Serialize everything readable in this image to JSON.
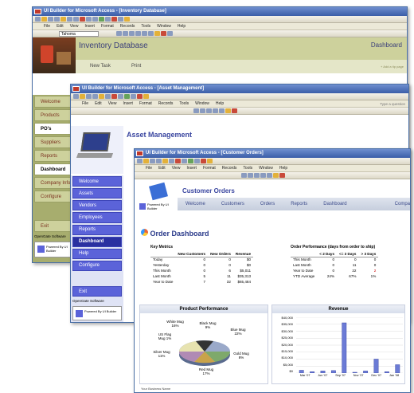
{
  "win1": {
    "title": "UI Builder for Microsoft Access - [Inventory Database]",
    "menu": [
      "File",
      "Edit",
      "View",
      "Insert",
      "Format",
      "Records",
      "Tools",
      "Window",
      "Help"
    ],
    "font": "Tahoma",
    "header": "Inventory Database",
    "right_title": "Dashboard",
    "new_task": "New Task",
    "print": "Print",
    "side": [
      "Welcome",
      "Products",
      "PO's",
      "Suppliers",
      "Reports",
      "Dashboard",
      "Company Info",
      "Configure",
      "Exit"
    ],
    "footer": "OpenGate Software",
    "powered": "Powered By UI Builder",
    "link": "+ Add a tip page"
  },
  "win2": {
    "title": "UI Builder for Microsoft Access - [Asset Management]",
    "menu": [
      "File",
      "Edit",
      "View",
      "Insert",
      "Format",
      "Records",
      "Tools",
      "Window",
      "Help"
    ],
    "help_box": "Type a question",
    "header": "Asset Management",
    "side": [
      "Welcome",
      "Assets",
      "Vendors",
      "Employees",
      "Reports",
      "Dashboard",
      "Help",
      "Configure",
      "Exit"
    ],
    "footer": "OpenGate Software",
    "powered": "Powered By UI Builder"
  },
  "win3": {
    "title": "UI Builder for Microsoft Access - [Customer Orders]",
    "menu": [
      "File",
      "Edit",
      "View",
      "Insert",
      "Format",
      "Records",
      "Tools",
      "Window",
      "Help"
    ],
    "header": "Customer Orders",
    "tabs": [
      "Welcome",
      "Customers",
      "Orders",
      "Reports",
      "Dashboard",
      "Compa"
    ],
    "powered": "Powered By UI Builder",
    "dash_title": "Order Dashboard",
    "key_metrics": {
      "title": "Key Metrics",
      "headers": [
        "",
        "New Customers",
        "New Orders",
        "Revenue"
      ],
      "rows": [
        [
          "Today",
          "0",
          "0",
          "$0"
        ],
        [
          "Yesterday",
          "0",
          "0",
          "$0"
        ],
        [
          "This Month",
          "0",
          "6",
          "$5,011"
        ],
        [
          "Last Month",
          "5",
          "11",
          "$35,313"
        ],
        [
          "Year to Date",
          "7",
          "32",
          "$65,484"
        ]
      ]
    },
    "order_perf": {
      "title": "Order Performance (days from order to ship)",
      "headers": [
        "",
        "< 2 Days",
        "<= 3 Days",
        "> 3 Days"
      ],
      "rows": [
        [
          "This Month",
          "0",
          "0",
          "0"
        ],
        [
          "Last Month",
          "0",
          "11",
          "0"
        ],
        [
          "Year to Date",
          "0",
          "22",
          "2"
        ],
        [
          "YTD Average",
          "24%",
          "67%",
          "1%"
        ]
      ]
    },
    "product_perf": {
      "title": "Product Performance",
      "labels": [
        "White Mug 16%",
        "Black Mug 9%",
        "Blue Mug 22%",
        "US Flag Mug 1%",
        "Silver Mug 11%",
        "Red Mug 17%",
        "Gold Mug 8%"
      ]
    },
    "revenue": {
      "title": "Revenue",
      "yticks": [
        "$40,000",
        "$35,000",
        "$30,000",
        "$25,000",
        "$20,000",
        "$15,000",
        "$10,000",
        "$5,000",
        "$0"
      ],
      "xticks": [
        "Mar '07",
        "Jun '07",
        "Sep '07",
        "Nov '07",
        "Dec '07",
        "Jan '08"
      ],
      "values": [
        2000,
        1000,
        1500,
        1800,
        36000,
        500,
        1500,
        10000,
        1000,
        6000
      ]
    },
    "footer": "Your Business Name"
  }
}
